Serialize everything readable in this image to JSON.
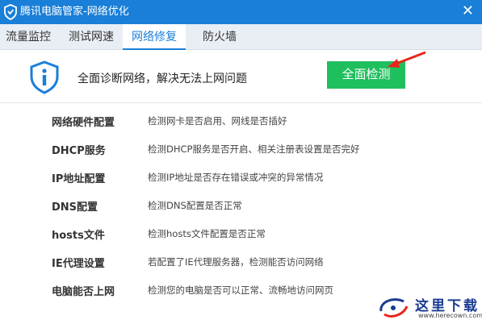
{
  "window": {
    "title": "腾讯电脑管家-网络优化",
    "close_glyph": "✕"
  },
  "tabs": [
    {
      "label": "流量监控",
      "active": false
    },
    {
      "label": "测试网速",
      "active": false
    },
    {
      "label": "网络修复",
      "active": true
    },
    {
      "label": "防火墙",
      "active": false
    }
  ],
  "header": {
    "message": "全面诊断网络，解决无法上网问题",
    "scan_button": "全面检测"
  },
  "checks": [
    {
      "name": "网络硬件配置",
      "desc": "检测网卡是否启用、网线是否插好"
    },
    {
      "name": "DHCP服务",
      "desc": "检测DHCP服务是否开启、相关注册表设置是否完好"
    },
    {
      "name": "IP地址配置",
      "desc": "检测IP地址是否存在错误或冲突的异常情况"
    },
    {
      "name": "DNS配置",
      "desc": "检测DNS配置是否正常"
    },
    {
      "name": "hosts文件",
      "desc": "检测hosts文件配置是否正常"
    },
    {
      "name": "IE代理设置",
      "desc": "若配置了IE代理服务器，检测能否访问网络"
    },
    {
      "name": "电脑能否上网",
      "desc": "检测您的电脑是否可以正常、流畅地访问网页"
    }
  ],
  "watermark": {
    "text": "这里下载",
    "url": "www.herecown.com"
  },
  "colors": {
    "titlebar": "#1a7fd8",
    "accent": "#1a7fd8",
    "scan_button": "#1fbf5e",
    "arrow": "#e8251c"
  }
}
